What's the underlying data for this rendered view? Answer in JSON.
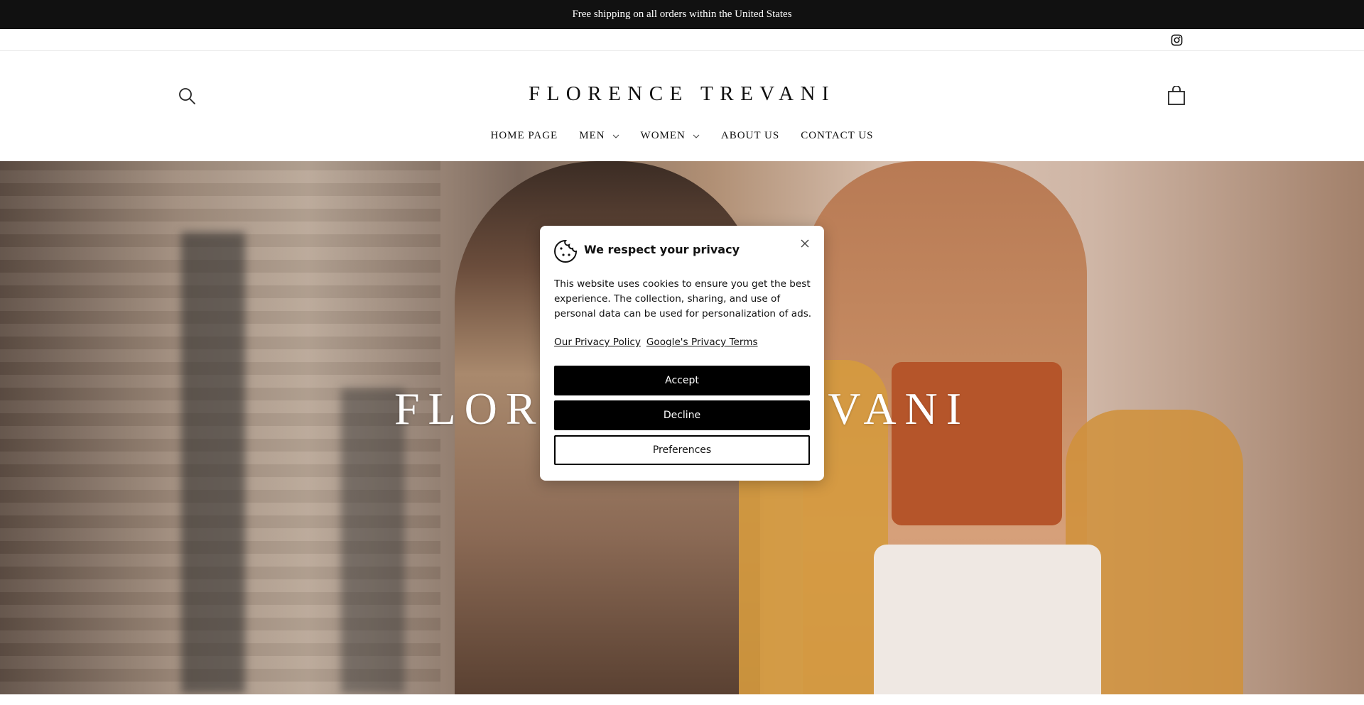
{
  "announcement": {
    "text": "Free shipping on all orders within the United States"
  },
  "header": {
    "logo": "FLORENCE TREVANI",
    "nav": [
      {
        "label": "HOME PAGE",
        "has_dropdown": false
      },
      {
        "label": "MEN",
        "has_dropdown": true
      },
      {
        "label": "WOMEN",
        "has_dropdown": true
      },
      {
        "label": "ABOUT US",
        "has_dropdown": false
      },
      {
        "label": "CONTACT US",
        "has_dropdown": false
      }
    ],
    "icons": {
      "search": "search-icon",
      "cart": "cart-icon",
      "social": "instagram-icon"
    }
  },
  "hero": {
    "title": "FLORENCE TREVANI"
  },
  "cookie_banner": {
    "heading": "We respect your privacy",
    "body": "This website uses cookies to ensure you get the best experience. The collection, sharing, and use of personal data can be used for personalization of ads.",
    "links": [
      "Our Privacy Policy",
      "Google's Privacy Terms"
    ],
    "accept_label": "Accept",
    "decline_label": "Decline",
    "preferences_label": "Preferences"
  },
  "colors": {
    "announcement_bg": "#111111",
    "button_dark": "#000000",
    "accent_top": "#b5552a"
  }
}
